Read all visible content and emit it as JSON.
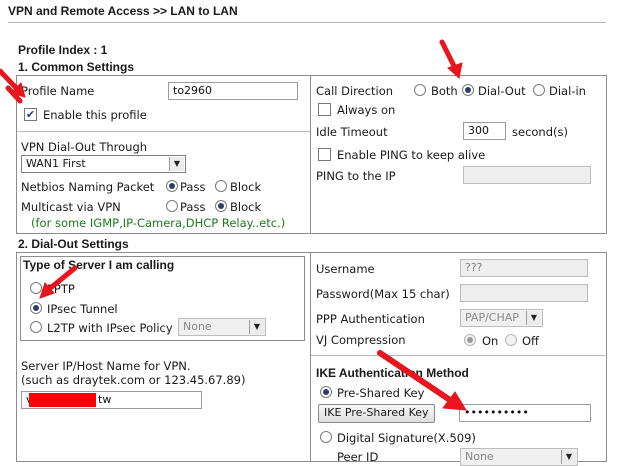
{
  "page": {
    "breadcrumb": "VPN and Remote Access >> LAN to LAN",
    "profile_index": "Profile Index : 1"
  },
  "common_settings": {
    "title": "1. Common Settings",
    "profile_name_label": "Profile Name",
    "profile_name_value": "to2960",
    "enable_profile_label": "Enable this profile",
    "enable_profile_checked": true,
    "dialout_through_label": "VPN Dial-Out Through",
    "dialout_through_value": "WAN1 First",
    "netbios_label": "Netbios Naming Packet",
    "netbios_options": [
      "Pass",
      "Block"
    ],
    "netbios_selected": "Pass",
    "multicast_label": "Multicast via VPN",
    "multicast_options": [
      "Pass",
      "Block"
    ],
    "multicast_selected": "Block",
    "multicast_note": "(for some IGMP,IP-Camera,DHCP Relay..etc.)",
    "call_direction_label": "Call Direction",
    "call_direction_options": [
      "Both",
      "Dial-Out",
      "Dial-in"
    ],
    "call_direction_selected": "Dial-Out",
    "always_on_label": "Always on",
    "idle_timeout_label": "Idle Timeout",
    "idle_timeout_value": "300",
    "idle_timeout_unit": "second(s)",
    "enable_ping_label": "Enable PING to keep alive",
    "ping_ip_label": "PING to the IP",
    "ping_ip_value": ""
  },
  "dialout_settings": {
    "title": "2. Dial-Out Settings",
    "server_type_title": "Type of Server I am calling",
    "server_options": [
      "PPTP",
      "IPsec Tunnel",
      "L2TP with IPsec Policy"
    ],
    "server_selected": "IPsec Tunnel",
    "l2tp_policy_value": "None",
    "server_host_label_1": "Server IP/Host Name for VPN.",
    "server_host_label_2": "(such as draytek.com or 123.45.67.89)",
    "server_host_value_prefix": "v",
    "server_host_value_suffix": "tw",
    "username_label": "Username",
    "username_value": "???",
    "password_label": "Password(Max 15 char)",
    "password_value": "",
    "ppp_auth_label": "PPP Authentication",
    "ppp_auth_value": "PAP/CHAP",
    "vj_label": "VJ Compression",
    "vj_options": [
      "On",
      "Off"
    ],
    "vj_selected": "On",
    "ike_title": "IKE Authentication Method",
    "psk_label": "Pre-Shared Key",
    "psk_button": "IKE Pre-Shared Key",
    "psk_value": "••••••••••",
    "digital_sig_label": "Digital Signature(X.509)",
    "peer_id_label": "Peer ID",
    "peer_id_value": "None"
  },
  "colors": {
    "annotation_arrow": "#e8141e",
    "note_green": "#1c7a1c",
    "radio_dot": "#2c3e70"
  }
}
